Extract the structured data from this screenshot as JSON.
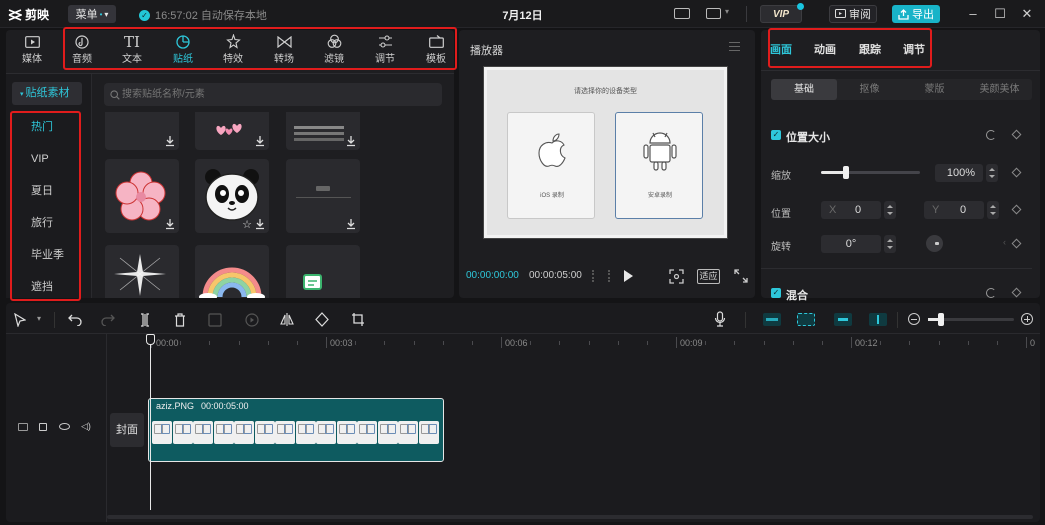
{
  "app": {
    "name": "剪映",
    "menu_label": "菜单",
    "autosave_text": "16:57:02 自动保存本地",
    "project_title": "7月12日",
    "vip_label": "VIP",
    "review_label": "审阅",
    "export_label": "导出"
  },
  "media_tabs": [
    {
      "label": "媒体",
      "icon": "media-icon"
    },
    {
      "label": "音频",
      "icon": "audio-icon"
    },
    {
      "label": "文本",
      "icon": "text-icon"
    },
    {
      "label": "贴纸",
      "icon": "sticker-icon",
      "active": true
    },
    {
      "label": "特效",
      "icon": "effects-icon"
    },
    {
      "label": "转场",
      "icon": "transition-icon"
    },
    {
      "label": "滤镜",
      "icon": "filter-icon"
    },
    {
      "label": "调节",
      "icon": "adjust-icon"
    },
    {
      "label": "模板",
      "icon": "template-icon"
    }
  ],
  "sticker_panel": {
    "section_label": "贴纸素材",
    "search_placeholder": "搜索贴纸名称/元素",
    "categories": [
      "热门",
      "VIP",
      "夏日",
      "旅行",
      "毕业季",
      "遮挡"
    ],
    "active_category": "热门"
  },
  "player": {
    "title": "播放器",
    "device_prompt": "请选择你的设备类型",
    "ios_label": "iOS 录制",
    "android_label": "安卓录制",
    "current_time": "00:00:00:00",
    "total_time": "00:00:05:00",
    "ratio_label": "适应"
  },
  "inspector": {
    "tabs": [
      "画面",
      "动画",
      "跟踪",
      "调节"
    ],
    "active_tab": "画面",
    "subtabs": [
      "基础",
      "抠像",
      "蒙版",
      "美颜美体"
    ],
    "active_subtab": "基础",
    "position_size_title": "位置大小",
    "scale_label": "缩放",
    "scale_value": "100%",
    "scale_fraction": 0.25,
    "position_label": "位置",
    "x_label": "X",
    "x_value": "0",
    "y_label": "Y",
    "y_value": "0",
    "rotate_label": "旋转",
    "rotate_value": "0°",
    "blend_title": "混合"
  },
  "timeline": {
    "ticks": [
      "00:00",
      "00:03",
      "00:06",
      "00:09",
      "00:12",
      "0"
    ],
    "cover_label": "封面",
    "clip_name": "aziz.PNG",
    "clip_duration": "00:00:05:00"
  },
  "colors": {
    "accent": "#2ec7da",
    "clip": "#0e5b60",
    "highlight_box": "#e01c1c",
    "export_bg": "#18b3c8"
  }
}
